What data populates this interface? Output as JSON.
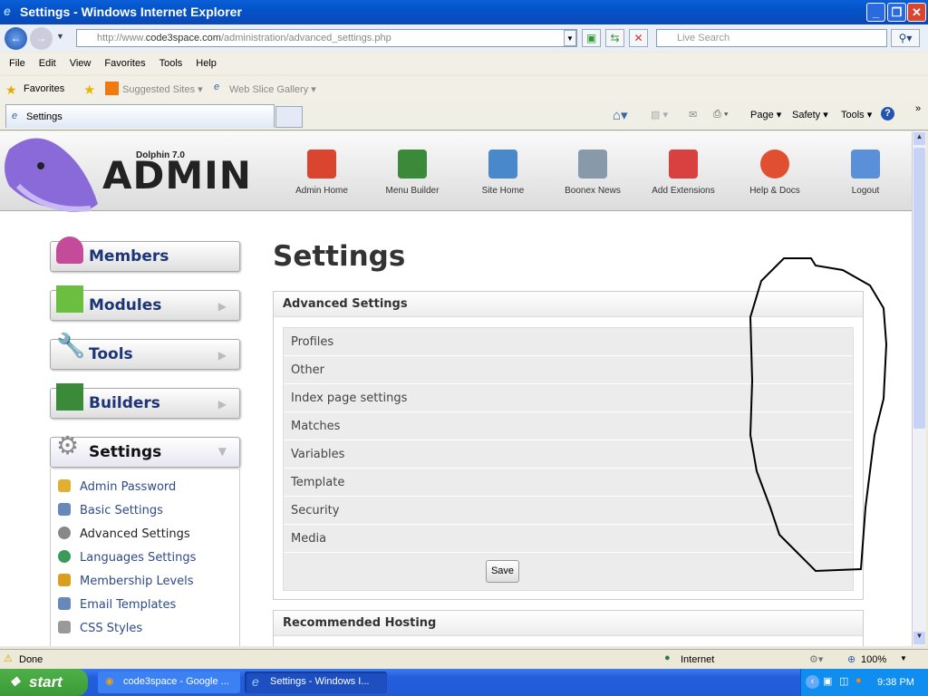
{
  "window": {
    "title": "Settings - Windows Internet Explorer"
  },
  "address": {
    "url_prefix": "http://www.",
    "url_domain": "code3space.com",
    "url_path": "/administration/advanced_settings.php",
    "search_placeholder": "Live Search"
  },
  "menu": [
    "File",
    "Edit",
    "View",
    "Favorites",
    "Tools",
    "Help"
  ],
  "favorites": {
    "label": "Favorites",
    "suggested": "Suggested Sites ▾",
    "webslice": "Web Slice Gallery ▾"
  },
  "tab": {
    "label": "Settings"
  },
  "commandbar": {
    "page": "Page ▾",
    "safety": "Safety ▾",
    "tools": "Tools ▾"
  },
  "site": {
    "version": "Dolphin 7.0",
    "logo": "ADMIN",
    "nav": [
      {
        "label": "Admin Home",
        "color": "#d9452e"
      },
      {
        "label": "Menu Builder",
        "color": "#3a8a3a"
      },
      {
        "label": "Site Home",
        "color": "#4a88cc"
      },
      {
        "label": "Boonex News",
        "color": "#8899aa"
      },
      {
        "label": "Add Extensions",
        "color": "#d94040"
      },
      {
        "label": "Help & Docs",
        "color": "#e05030"
      },
      {
        "label": "Logout",
        "color": "#5a90d8"
      }
    ]
  },
  "sidebar": {
    "boxes": [
      {
        "label": "Members",
        "color": "#c44a9a"
      },
      {
        "label": "Modules",
        "color": "#6abf40"
      },
      {
        "label": "Tools",
        "color": "#555"
      },
      {
        "label": "Builders",
        "color": "#3a8a3a"
      },
      {
        "label": "Settings",
        "color": "#888"
      }
    ],
    "submenu": [
      {
        "label": "Admin Password",
        "color": "#e0b030"
      },
      {
        "label": "Basic Settings",
        "color": "#6688bb"
      },
      {
        "label": "Advanced Settings",
        "color": "#888"
      },
      {
        "label": "Languages Settings",
        "color": "#3a9a5a"
      },
      {
        "label": "Membership Levels",
        "color": "#d9a020"
      },
      {
        "label": "Email Templates",
        "color": "#6688bb"
      },
      {
        "label": "CSS Styles",
        "color": "#999"
      }
    ]
  },
  "main": {
    "title": "Settings",
    "panel_title": "Advanced Settings",
    "rows": [
      "Profiles",
      "Other",
      "Index page settings",
      "Matches",
      "Variables",
      "Template",
      "Security",
      "Media"
    ],
    "save": "Save",
    "panel2_title": "Recommended Hosting"
  },
  "status": {
    "text": "Done",
    "zone": "Internet",
    "zoom": "100%"
  },
  "taskbar": {
    "start": "start",
    "tasks": [
      "code3space - Google ...",
      "Settings - Windows I..."
    ],
    "clock": "9:38 PM"
  }
}
